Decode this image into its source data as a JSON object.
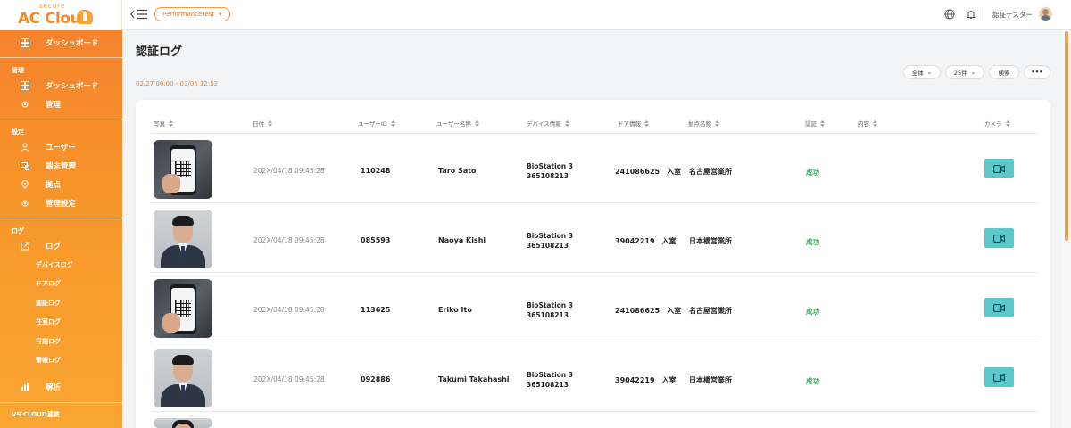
{
  "brand": {
    "secure_text": "secure",
    "name": "AC Cloud"
  },
  "sidebar": {
    "dashboard_top": "ダッシュボード",
    "section_manage": "管理",
    "manage_items": [
      "ダッシュボード",
      "管理"
    ],
    "section_settings": "設定",
    "settings_items": [
      "ユーザー",
      "端末管理",
      "拠点",
      "管理設定"
    ],
    "section_log": "ログ",
    "log_item": "ログ",
    "log_subitems": [
      "デバイスログ",
      "ドアログ",
      "認証ログ",
      "在室ログ",
      "打刻ログ",
      "警報ログ"
    ],
    "analysis_item": "解析",
    "section_vs": "VS CLOUD連携"
  },
  "topbar": {
    "project": "PerformanceTest",
    "user": "認証テスター"
  },
  "page": {
    "title": "認証ログ",
    "date_range": "02/27 00:00 - 03/05 12:52",
    "filter_all": "全体",
    "page_size": "25件",
    "search": "検索",
    "more": "•••"
  },
  "table": {
    "headers": [
      "写真",
      "日付",
      "ユーザーID",
      "ユーザー名称",
      "デバイス情報",
      "ドア情報",
      "拠点名称",
      "認証",
      "内容",
      "カメラ"
    ],
    "rows": [
      {
        "photo": "qr",
        "date": "202X/04/18 09:45:28",
        "user_id": "110248",
        "user_name": "Taro Sato",
        "device_line1": "BioStation 3",
        "device_line2": "365108213",
        "door": "241086625　入室",
        "site": "名古屋営業所",
        "auth": "成功"
      },
      {
        "photo": "face",
        "date": "202X/04/18 09:45:28",
        "user_id": "085593",
        "user_name": "Naoya Kishi",
        "device_line1": "BioStation 3",
        "device_line2": "365108213",
        "door": "39042219　入室",
        "site": "日本橋営業所",
        "auth": "成功"
      },
      {
        "photo": "qr",
        "date": "202X/04/18 09:45:28",
        "user_id": "113625",
        "user_name": "Eriko Ito",
        "device_line1": "BioStation 3",
        "device_line2": "365108213",
        "door": "241086625　入室",
        "site": "名古屋営業所",
        "auth": "成功"
      },
      {
        "photo": "face",
        "date": "202X/04/18 09:45:28",
        "user_id": "092886",
        "user_name": "Takumi Takahashi",
        "device_line1": "BioStation 3",
        "device_line2": "365108213",
        "door": "39042219　入室",
        "site": "日本橋営業所",
        "auth": "成功"
      }
    ]
  },
  "colors": {
    "accent": "#f4882c",
    "success": "#2fb15a",
    "camera": "#5cc8c9"
  }
}
